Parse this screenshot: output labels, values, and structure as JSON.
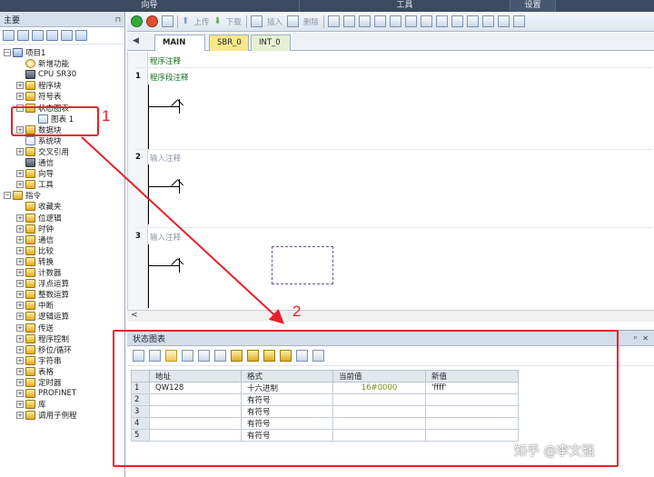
{
  "top_bar": {
    "tabs": [
      "向导",
      "工具",
      "设置"
    ]
  },
  "left_panel": {
    "title": "主要",
    "pin": "⊓",
    "tree": [
      {
        "label": "项目1",
        "level": 0,
        "expander": "−",
        "icon": "project"
      },
      {
        "label": "新增功能",
        "level": 1,
        "expander": "",
        "icon": "star"
      },
      {
        "label": "CPU SR30",
        "level": 1,
        "expander": "",
        "icon": "cpu"
      },
      {
        "label": "程序块",
        "level": 1,
        "expander": "+",
        "icon": "yellow"
      },
      {
        "label": "符号表",
        "level": 1,
        "expander": "+",
        "icon": "yellow"
      },
      {
        "label": "状态图表",
        "level": 1,
        "expander": "−",
        "icon": "yellow"
      },
      {
        "label": "图表 1",
        "level": 2,
        "expander": "",
        "icon": "table"
      },
      {
        "label": "数据块",
        "level": 1,
        "expander": "+",
        "icon": "yellow"
      },
      {
        "label": "系统块",
        "level": 1,
        "expander": "",
        "icon": "doc"
      },
      {
        "label": "交叉引用",
        "level": 1,
        "expander": "+",
        "icon": "yellow"
      },
      {
        "label": "通信",
        "level": 1,
        "expander": "",
        "icon": "cpu"
      },
      {
        "label": "向导",
        "level": 1,
        "expander": "+",
        "icon": "yellow"
      },
      {
        "label": "工具",
        "level": 1,
        "expander": "+",
        "icon": "yellow"
      },
      {
        "label": "指令",
        "level": 0,
        "expander": "−",
        "icon": "yellow"
      },
      {
        "label": "收藏夹",
        "level": 1,
        "expander": "",
        "icon": "yellow"
      },
      {
        "label": "位逻辑",
        "level": 1,
        "expander": "+",
        "icon": "yellow"
      },
      {
        "label": "时钟",
        "level": 1,
        "expander": "+",
        "icon": "yellow"
      },
      {
        "label": "通信",
        "level": 1,
        "expander": "+",
        "icon": "yellow"
      },
      {
        "label": "比较",
        "level": 1,
        "expander": "+",
        "icon": "yellow"
      },
      {
        "label": "转换",
        "level": 1,
        "expander": "+",
        "icon": "yellow"
      },
      {
        "label": "计数器",
        "level": 1,
        "expander": "+",
        "icon": "yellow"
      },
      {
        "label": "浮点运算",
        "level": 1,
        "expander": "+",
        "icon": "yellow"
      },
      {
        "label": "整数运算",
        "level": 1,
        "expander": "+",
        "icon": "yellow"
      },
      {
        "label": "中断",
        "level": 1,
        "expander": "+",
        "icon": "yellow"
      },
      {
        "label": "逻辑运算",
        "level": 1,
        "expander": "+",
        "icon": "yellow"
      },
      {
        "label": "传送",
        "level": 1,
        "expander": "+",
        "icon": "yellow"
      },
      {
        "label": "程序控制",
        "level": 1,
        "expander": "+",
        "icon": "yellow"
      },
      {
        "label": "移位/循环",
        "level": 1,
        "expander": "+",
        "icon": "yellow"
      },
      {
        "label": "字符串",
        "level": 1,
        "expander": "+",
        "icon": "yellow"
      },
      {
        "label": "表格",
        "level": 1,
        "expander": "+",
        "icon": "yellow"
      },
      {
        "label": "定时器",
        "level": 1,
        "expander": "+",
        "icon": "yellow"
      },
      {
        "label": "PROFINET",
        "level": 1,
        "expander": "+",
        "icon": "yellow"
      },
      {
        "label": "库",
        "level": 1,
        "expander": "+",
        "icon": "yellow"
      },
      {
        "label": "调用子例程",
        "level": 1,
        "expander": "+",
        "icon": "yellow"
      }
    ]
  },
  "toolbar": {
    "upload": "上传",
    "download": "下载",
    "insert": "插入",
    "delete": "删除"
  },
  "editor": {
    "tab_nav": "◀",
    "tabs": [
      "MAIN",
      "SBR_0",
      "INT_0"
    ],
    "close": "✕",
    "program_comment": "程序注释",
    "networks": [
      {
        "num": "1",
        "comment": "程序段注释"
      },
      {
        "num": "2",
        "comment": "输入注释"
      },
      {
        "num": "3",
        "comment": "输入注释"
      }
    ],
    "scroll_left": "<"
  },
  "status_chart": {
    "title": "状态图表",
    "actions": [
      "ᵖ",
      "✕"
    ],
    "columns": [
      "",
      "地址",
      "格式",
      "当前值",
      "新值"
    ],
    "rows": [
      {
        "num": "1",
        "address": "QW128",
        "format": "十六进制",
        "current": "16#0000",
        "new": "'ffff'"
      },
      {
        "num": "2",
        "address": "",
        "format": "有符号",
        "current": "",
        "new": ""
      },
      {
        "num": "3",
        "address": "",
        "format": "有符号",
        "current": "",
        "new": ""
      },
      {
        "num": "4",
        "address": "",
        "format": "有符号",
        "current": "",
        "new": ""
      },
      {
        "num": "5",
        "address": "",
        "format": "有符号",
        "current": "",
        "new": ""
      }
    ]
  },
  "annotations": {
    "label1": "1",
    "label2": "2"
  },
  "watermark": "知乎 @李文强",
  "colors": {
    "accent_red": "#e8202a",
    "tab_main": "#ffffff",
    "tab_sbr": "#f6e98a",
    "tab_int": "#e7f0d2"
  }
}
